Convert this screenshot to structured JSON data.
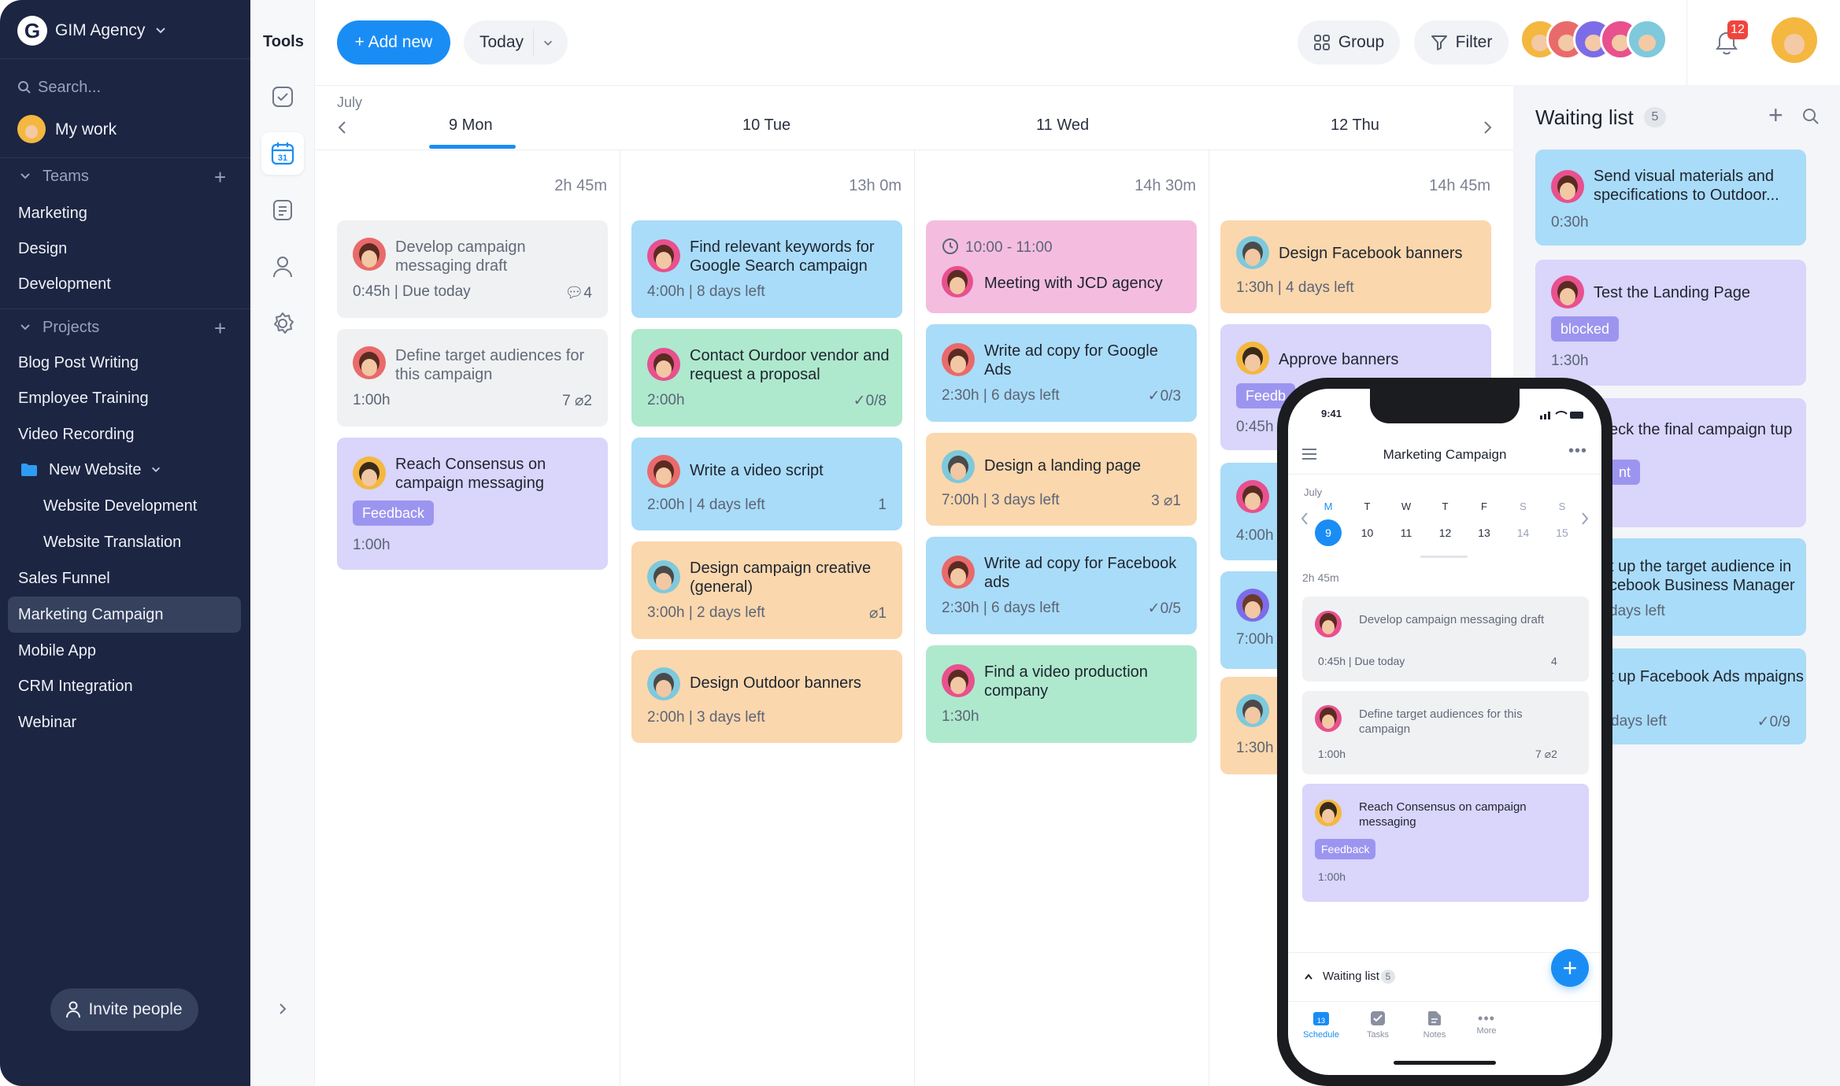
{
  "workspace": "GIM Agency",
  "search_placeholder": "Search...",
  "my_work": "My work",
  "teams": {
    "label": "Teams",
    "items": [
      "Marketing",
      "Design",
      "Development"
    ]
  },
  "projects": {
    "label": "Projects",
    "items": [
      "Blog Post Writing",
      "Employee Training",
      "Video Recording"
    ],
    "folder": "New Website",
    "folder_items": [
      "Website Development",
      "Website Translation"
    ],
    "more_items": [
      "Sales Funnel",
      "Marketing Campaign",
      "Mobile App",
      "CRM Integration",
      "Webinar"
    ],
    "active": "Marketing Campaign"
  },
  "invite": "Invite people",
  "tools_label": "Tools",
  "calendar_icon_day": "31",
  "header": {
    "add_new": "+ Add new",
    "today": "Today",
    "group": "Group",
    "filter": "Filter",
    "notifications": "12"
  },
  "calendar": {
    "month": "July",
    "days": [
      {
        "label": "9 Mon",
        "total": "2h 45m",
        "active": true
      },
      {
        "label": "10 Tue",
        "total": "13h 0m"
      },
      {
        "label": "11 Wed",
        "total": "14h 30m"
      },
      {
        "label": "12 Thu",
        "total": "14h 45m"
      }
    ]
  },
  "cards": {
    "mon": [
      {
        "title": "Develop campaign messaging draft",
        "meta": "0:45h | Due today",
        "icons": "4"
      },
      {
        "title": "Define target audiences for this campaign",
        "meta": "1:00h",
        "icons": "7 ⌀2"
      },
      {
        "title": "Reach Consensus on campaign messaging",
        "tag": "Feedback",
        "meta": "1:00h"
      }
    ],
    "tue": [
      {
        "title": "Find relevant keywords for Google Search campaign",
        "meta": "4:00h | 8 days left"
      },
      {
        "title": "Contact Ourdoor vendor and request a proposal",
        "meta": "2:00h",
        "icons": "✓0/8"
      },
      {
        "title": "Write a video script",
        "meta": "2:00h | 4 days left",
        "icons": "1"
      },
      {
        "title": "Design campaign creative (general)",
        "meta": "3:00h | 2 days left",
        "icons": "⌀1"
      },
      {
        "title": "Design Outdoor banners",
        "meta": "2:00h | 3 days left"
      }
    ],
    "wed": [
      {
        "time": "10:00 - 11:00",
        "title": "Meeting with JCD agency"
      },
      {
        "title": "Write ad copy for Google Ads",
        "meta": "2:30h | 6 days left",
        "icons": "✓0/3"
      },
      {
        "title": "Design a landing page",
        "meta": "7:00h | 3 days left",
        "icons": "3 ⌀1"
      },
      {
        "title": "Write ad copy for Facebook ads",
        "meta": "2:30h | 6 days left",
        "icons": "✓0/5"
      },
      {
        "title": "Find a video production company",
        "meta": "1:30h"
      }
    ],
    "thu": [
      {
        "title": "Design Facebook banners",
        "meta": "1:30h | 4 days left"
      },
      {
        "title": "Approve banners",
        "tag": "Feedb",
        "meta": "0:45h"
      },
      {
        "meta": "4:00h"
      },
      {
        "meta": "7:00h"
      },
      {
        "meta": "1:30h"
      }
    ]
  },
  "waiting": {
    "title": "Waiting list",
    "count": "5",
    "items": [
      {
        "title": "Send visual materials and specifications to Outdoor...",
        "meta": "0:30h"
      },
      {
        "title": "Test the Landing Page",
        "tag": "blocked",
        "meta": "1:30h"
      },
      {
        "title": "eck the final campaign tup",
        "tag": "nt"
      },
      {
        "title": "t up the target audience in cebook Business Manager",
        "meta": "days left"
      },
      {
        "title": "t up Facebook Ads mpaigns",
        "meta": "days left",
        "icons": "✓0/9"
      }
    ]
  },
  "phone": {
    "time": "9:41",
    "title": "Marketing Campaign",
    "month": "July",
    "weekdays": [
      "M",
      "T",
      "W",
      "T",
      "F",
      "S",
      "S"
    ],
    "dates": [
      "9",
      "10",
      "11",
      "12",
      "13",
      "14",
      "15"
    ],
    "total": "2h 45m",
    "cards": [
      {
        "title": "Develop campaign messaging draft",
        "meta": "0:45h | Due today",
        "icons": "4"
      },
      {
        "title": "Define target audiences for this campaign",
        "meta": "1:00h",
        "icons": "7 ⌀2"
      },
      {
        "title": "Reach Consensus on campaign messaging",
        "tag": "Feedback",
        "meta": "1:00h"
      }
    ],
    "waiting": "Waiting list",
    "waiting_count": "5",
    "tabs": [
      "Schedule",
      "Tasks",
      "Notes",
      "More"
    ],
    "schedule_day": "13"
  },
  "colors": {
    "accent": "#1a8df5",
    "sidebar": "#1c2542",
    "blue": "#a9dcf8",
    "green": "#aee9cd",
    "purple": "#d9d5fb",
    "orange": "#fbd7ad",
    "pink": "#f4bde0",
    "tag": "#9c95f0"
  }
}
